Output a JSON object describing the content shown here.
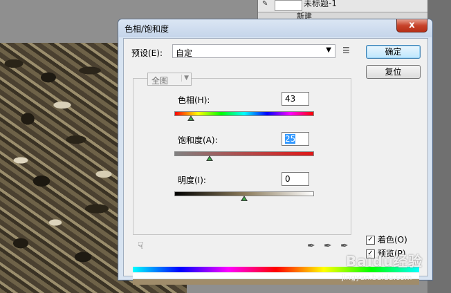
{
  "background_panel": {
    "title_fragment": "未标题-1",
    "row2_fragment": "新建"
  },
  "dialog": {
    "title": "色相/饱和度",
    "close_symbol": "x",
    "preset_label": "预设(E):",
    "preset_value": "自定",
    "ok_label": "确定",
    "reset_label": "复位",
    "channel_value": "全图",
    "sliders": [
      {
        "label": "色相(H):",
        "value": "43"
      },
      {
        "label": "饱和度(A):",
        "value": "25"
      },
      {
        "label": "明度(I):",
        "value": "0"
      }
    ],
    "colorize_label": "着色(O)",
    "preview_label": "预览(P)",
    "colorize_checked": true,
    "preview_checked": true
  },
  "watermark": {
    "brand": "Baidu经验",
    "url": "jingyan.baidu.com"
  }
}
